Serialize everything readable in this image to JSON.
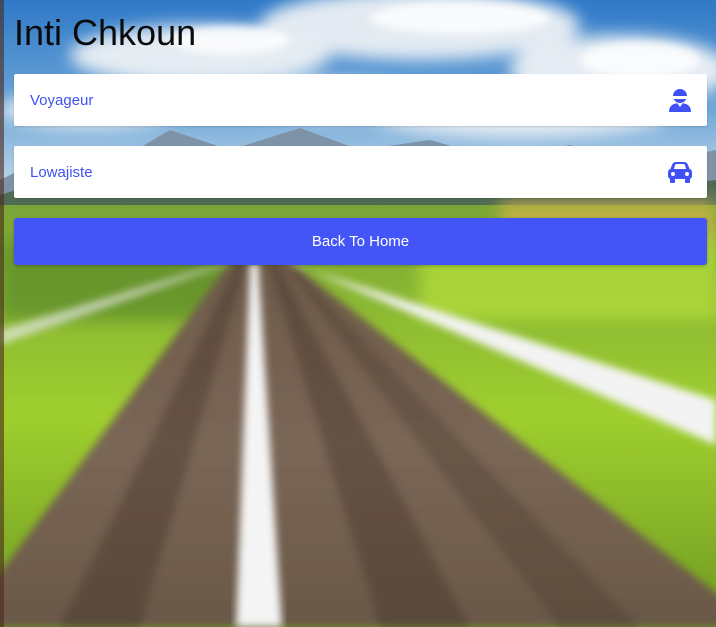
{
  "page": {
    "title": "Inti Chkoun"
  },
  "choices": [
    {
      "label": "Voyageur",
      "icon": "user-icon"
    },
    {
      "label": "Lowajiste",
      "icon": "car-icon"
    }
  ],
  "actions": {
    "back_home_label": "Back To Home"
  },
  "colors": {
    "accent": "#4355f7",
    "choice_text": "#3f51f5",
    "card_bg": "#ffffff"
  }
}
